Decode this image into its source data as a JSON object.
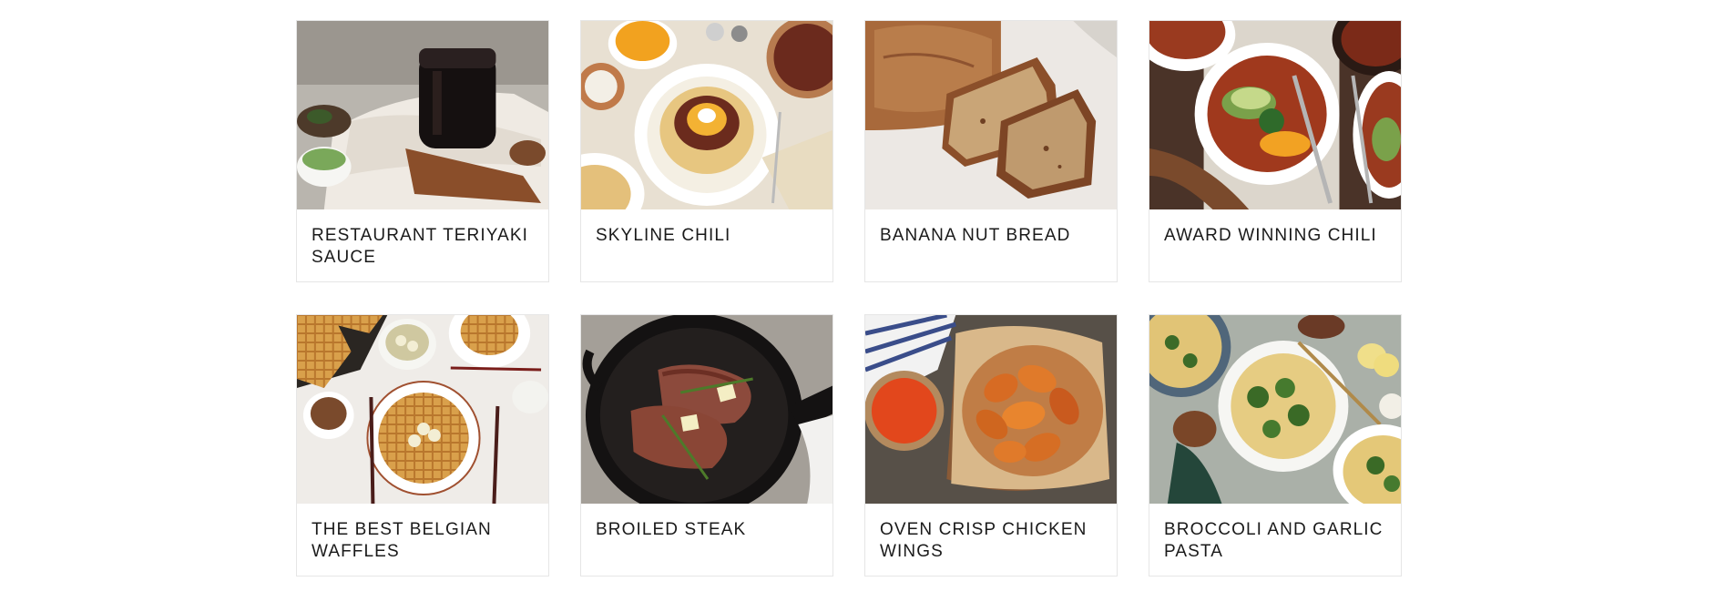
{
  "recipes": [
    {
      "title": "RESTAURANT TERIYAKI SAUCE",
      "image": "teriyaki-sauce-jar-photo"
    },
    {
      "title": "SKYLINE CHILI",
      "image": "skyline-chili-spaghetti-photo"
    },
    {
      "title": "BANANA NUT BREAD",
      "image": "banana-bread-slices-photo"
    },
    {
      "title": "AWARD WINNING CHILI",
      "image": "chili-bowls-avocado-photo"
    },
    {
      "title": "THE BEST BELGIAN WAFFLES",
      "image": "belgian-waffles-plate-photo"
    },
    {
      "title": "BROILED STEAK",
      "image": "steak-cast-iron-skillet-photo"
    },
    {
      "title": "OVEN CRISP CHICKEN WINGS",
      "image": "chicken-wings-platter-photo"
    },
    {
      "title": "BROCCOLI AND GARLIC PASTA",
      "image": "broccoli-pasta-plate-photo"
    }
  ]
}
